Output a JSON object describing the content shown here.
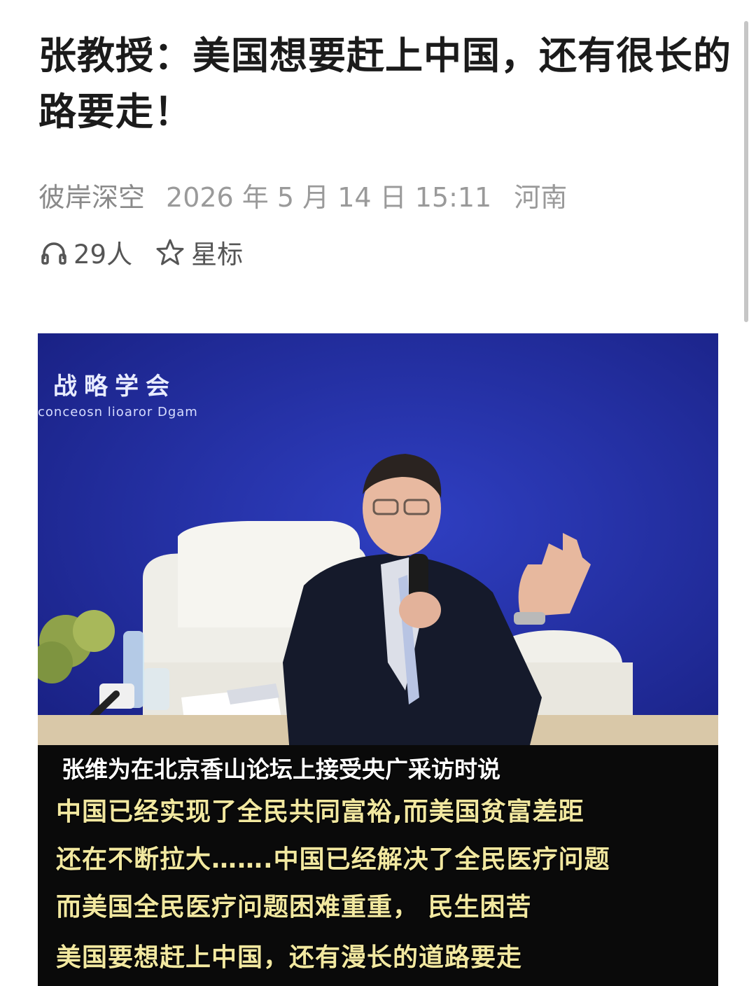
{
  "article": {
    "title": "张教授：美国想要赶上中国，还有很长的路要走！",
    "author": "彼岸深空",
    "date": "2026 年 5 月 14 日  15:11",
    "location": "河南",
    "listeners": "29人",
    "star_label": "星标"
  },
  "photo": {
    "banner_text": "战略学会",
    "banner_sub": "conceosn lioaror Dgam",
    "caption_lines": [
      "张维为在北京香山论坛上接受央广采访时说",
      "中国已经实现了全民共同富裕,而美国贫富差距",
      "还在不断拉大…….中国已经解决了全民医疗问题",
      "而美国全民医疗问题困难重重，  民生困苦",
      "美国要想赶上中国，还有漫长的道路要走"
    ]
  },
  "icons": {
    "listen": "headphones-icon",
    "star": "star-outline-icon"
  },
  "colors": {
    "title": "#1b1b1b",
    "meta": "#9a9a9a",
    "banner_blue": "#1e2a8f",
    "caption_yellow": "#f2e8a0"
  }
}
